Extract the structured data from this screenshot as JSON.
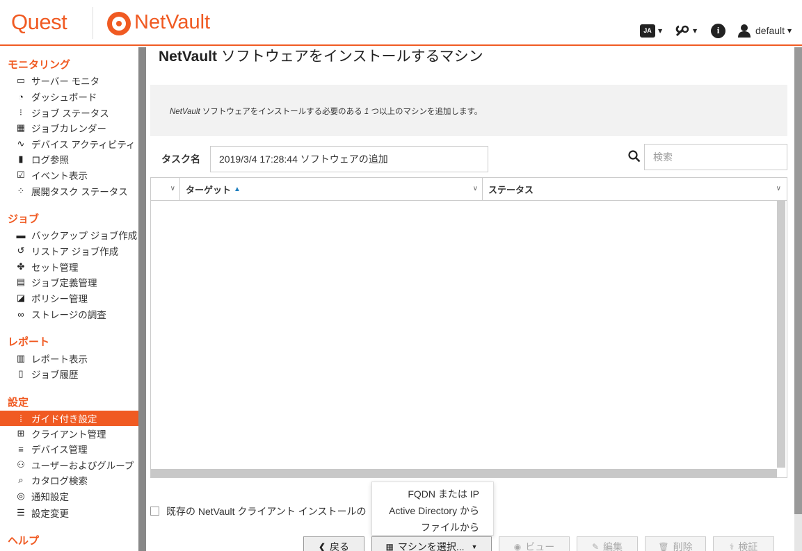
{
  "header": {
    "brand": "Quest",
    "product": "NetVault",
    "lang_badge": "JA",
    "user": "default",
    "icons": [
      "chat-language-icon",
      "tools-icon",
      "info-icon",
      "user-icon"
    ]
  },
  "sidebar": {
    "sections": [
      {
        "title": "モニタリング",
        "items": [
          {
            "label": "サーバー モニタ",
            "icon": "monitor-icon"
          },
          {
            "label": "ダッシュボード",
            "icon": "gauge-icon"
          },
          {
            "label": "ジョブ ステータス",
            "icon": "traffic-light-icon"
          },
          {
            "label": "ジョブカレンダー",
            "icon": "calendar-icon"
          },
          {
            "label": "デバイス アクティビティ",
            "icon": "activity-icon"
          },
          {
            "label": "ログ参照",
            "icon": "book-icon"
          },
          {
            "label": "イベント表示",
            "icon": "checkbox-calendar-icon"
          },
          {
            "label": "展開タスク ステータス",
            "icon": "spinner-icon"
          }
        ]
      },
      {
        "title": "ジョブ",
        "items": [
          {
            "label": "バックアップ ジョブ作成",
            "icon": "backup-icon"
          },
          {
            "label": "リストア ジョブ作成",
            "icon": "restore-icon"
          },
          {
            "label": "セット管理",
            "icon": "puzzle-icon"
          },
          {
            "label": "ジョブ定義管理",
            "icon": "clipboard-icon"
          },
          {
            "label": "ポリシー管理",
            "icon": "policy-icon"
          },
          {
            "label": "ストレージの調査",
            "icon": "binoculars-icon"
          }
        ]
      },
      {
        "title": "レポート",
        "items": [
          {
            "label": "レポート表示",
            "icon": "chart-icon"
          },
          {
            "label": "ジョブ履歴",
            "icon": "history-icon"
          }
        ]
      },
      {
        "title": "設定",
        "items": [
          {
            "label": "ガイド付き設定",
            "icon": "footsteps-icon",
            "active": true
          },
          {
            "label": "クライアント管理",
            "icon": "network-icon"
          },
          {
            "label": "デバイス管理",
            "icon": "server-icon"
          },
          {
            "label": "ユーザーおよびグループ",
            "icon": "users-icon"
          },
          {
            "label": "カタログ検索",
            "icon": "catalog-search-icon"
          },
          {
            "label": "通知設定",
            "icon": "bell-icon"
          },
          {
            "label": "設定変更",
            "icon": "sliders-icon"
          }
        ]
      },
      {
        "title": "ヘルプ",
        "items": []
      }
    ]
  },
  "main": {
    "title_bold": "NetVault",
    "title_rest": " ソフトウェアをインストールするマシン",
    "info_italic": "NetVault",
    "info_rest": " ソフトウェアをインストールする必要のある ",
    "info_num": "1",
    "info_tail": " つ以上のマシンを追加します。",
    "task_label": "タスク名",
    "task_value": "2019/3/4 17:28:44 ソフトウェアの追加",
    "search_placeholder": "検索",
    "table": {
      "columns": [
        "ターゲット",
        "ステータス"
      ],
      "rows": []
    },
    "checkbox_label": "既存の NetVault クライアント インストールの",
    "dropdown_items": [
      "FQDN または IP",
      "Active Directory から",
      "ファイルから"
    ],
    "buttons": {
      "back": "戻る",
      "select_machine": "マシンを選択...",
      "view": "ビュー",
      "edit": "編集",
      "delete": "削除",
      "verify": "検証"
    }
  }
}
